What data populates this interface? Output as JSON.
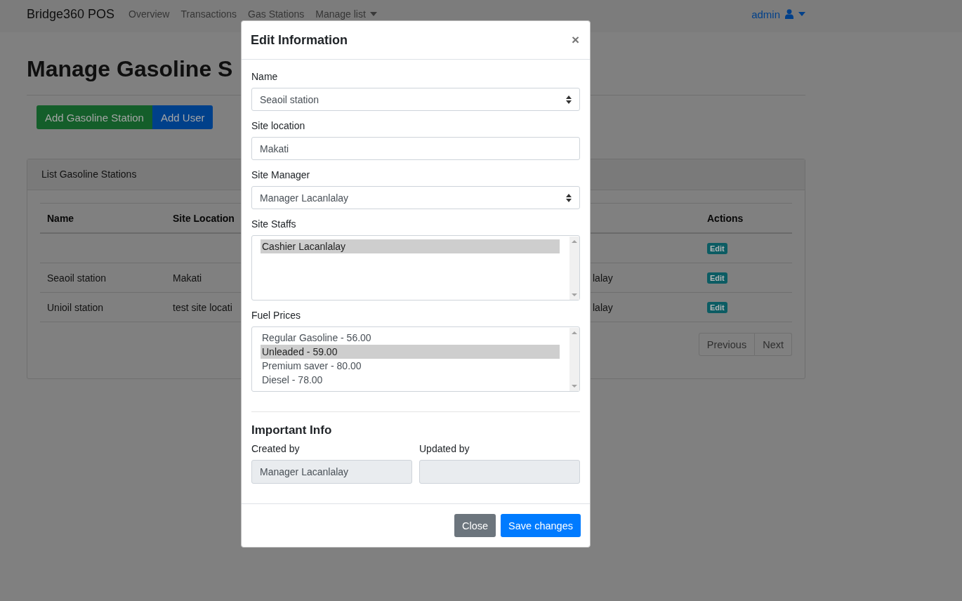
{
  "navbar": {
    "brand": "Bridge360 POS",
    "links": [
      {
        "label": "Overview",
        "kind": "link"
      },
      {
        "label": "Transactions",
        "kind": "link"
      },
      {
        "label": "Gas Stations",
        "kind": "link"
      },
      {
        "label": "Manage list",
        "kind": "dropdown"
      }
    ],
    "user": {
      "label": "admin"
    }
  },
  "page": {
    "title": "Manage Gasoline S",
    "buttons": [
      {
        "label": "Add Gasoline Station",
        "kind": "success"
      },
      {
        "label": "Add User",
        "kind": "primary"
      }
    ],
    "card": {
      "title": "List Gasoline Stations",
      "table": {
        "columns": {
          "name": "Name",
          "site_location": "Site Location",
          "actions": "Actions"
        },
        "rows": [
          {
            "action": "Edit"
          },
          {
            "name": "Seaoil station",
            "site_location": "Makati",
            "column_3": "lalay",
            "action": "Edit"
          },
          {
            "name": "Unioil station",
            "site_location": "test site locati",
            "column_3": "lalay",
            "action": "Edit"
          }
        ]
      },
      "pagination": [
        "Previous",
        "Next"
      ]
    }
  },
  "modal": {
    "title": "Edit Information",
    "close": "×",
    "fields": [
      {
        "kind": "select",
        "label": "Name",
        "value": "Seaoil station"
      },
      {
        "kind": "text",
        "label": "Site location",
        "value": "Makati"
      },
      {
        "kind": "select",
        "label": "Site Manager",
        "value": "Manager Lacanlalay"
      },
      {
        "kind": "listbox",
        "label": "Site Staffs",
        "options": [
          {
            "label": "Cashier Lacanlalay",
            "selected": true
          }
        ]
      },
      {
        "kind": "listbox",
        "label": "Fuel Prices",
        "options": [
          {
            "label": "Regular Gasoline - 56.00",
            "selected": false
          },
          {
            "label": "Unleaded - 59.00",
            "selected": true
          },
          {
            "label": "Premium saver - 80.00",
            "selected": false
          },
          {
            "label": "Diesel - 78.00",
            "selected": false
          }
        ]
      }
    ],
    "section_title": "Important Info",
    "info_fields": [
      {
        "label": "Created by",
        "value": "Manager Lacanlalay",
        "disabled": true
      },
      {
        "label": "Updated by",
        "disabled": true
      }
    ],
    "buttons": [
      {
        "label": "Close",
        "kind": "secondary"
      },
      {
        "label": "Save changes",
        "kind": "primary"
      }
    ]
  }
}
